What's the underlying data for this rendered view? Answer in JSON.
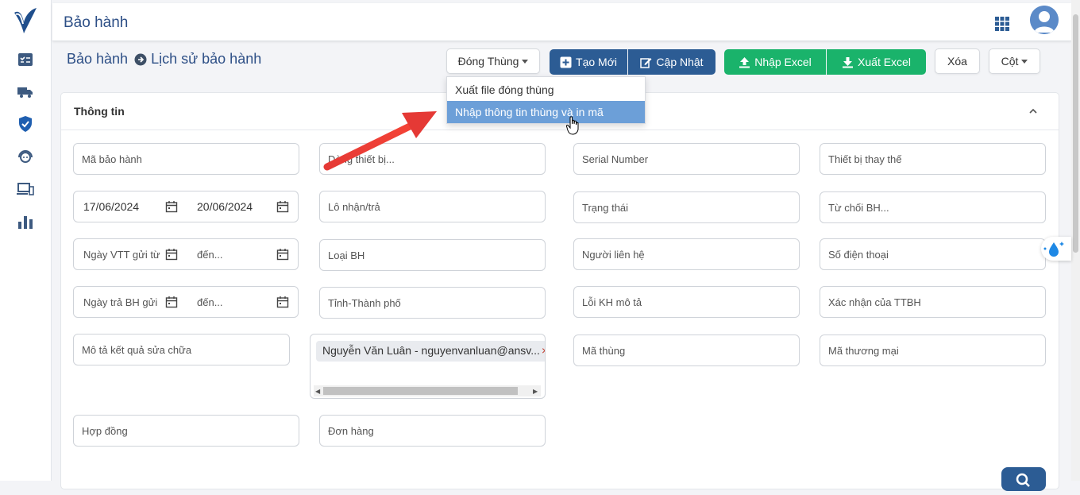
{
  "header": {
    "title": "Bảo hành"
  },
  "breadcrumb": {
    "root": "Bảo hành",
    "current": "Lịch sử bảo hành"
  },
  "toolbar": {
    "dong_thung": "Đóng Thùng",
    "tao_moi": "Tạo Mới",
    "cap_nhat": "Cập Nhật",
    "nhap_excel": "Nhập Excel",
    "xuat_excel": "Xuất Excel",
    "xoa": "Xóa",
    "cot": "Cột"
  },
  "dropdown": {
    "items": [
      "Xuất file đóng thùng",
      "Nhập thông tin thùng và in mã"
    ],
    "highlighted_index": 1
  },
  "card": {
    "title": "Thông tin"
  },
  "fields": {
    "ma_bao_hanh": "Mã bảo hành",
    "dong_thiet_bi": "Dòng thiết bị...",
    "serial_number": "Serial Number",
    "thiet_bi_thay_the": "Thiết bị thay thế",
    "date_from": "17/06/2024",
    "date_to": "20/06/2024",
    "lo_nhan_tra": "Lô nhận/trả",
    "trang_thai": "Trạng thái",
    "tu_choi_bh": "Từ chối BH...",
    "ngay_vtt_gui_tu": "Ngày VTT gửi từ",
    "ngay_vtt_den": "đến...",
    "loai_bh": "Loại BH",
    "nguoi_lien_he": "Người liên hệ",
    "so_dien_thoai": "Số điện thoại",
    "ngay_tra_bh_gui": "Ngày trả BH gửi",
    "ngay_tra_den": "đến...",
    "tinh_thanh_pho": "Tỉnh-Thành phố",
    "loi_kh_mo_ta": "Lỗi KH mô tả",
    "xac_nhan_ttbh": "Xác nhận của TTBH",
    "mo_ta_ket_qua": "Mô tả kết quả sửa chữa",
    "selected_user_tag": "Nguyễn Văn Luân - nguyenvanluan@ansv...",
    "ma_thung": "Mã thùng",
    "ma_thuong_mai": "Mã thương mại",
    "hop_dong": "Hợp đồng",
    "don_hang": "Đơn hàng"
  },
  "colors": {
    "primary_navy": "#2c5c94",
    "success_green": "#1ab36b",
    "highlight_blue": "#6c9fd8",
    "annotation_red": "#e53935"
  }
}
